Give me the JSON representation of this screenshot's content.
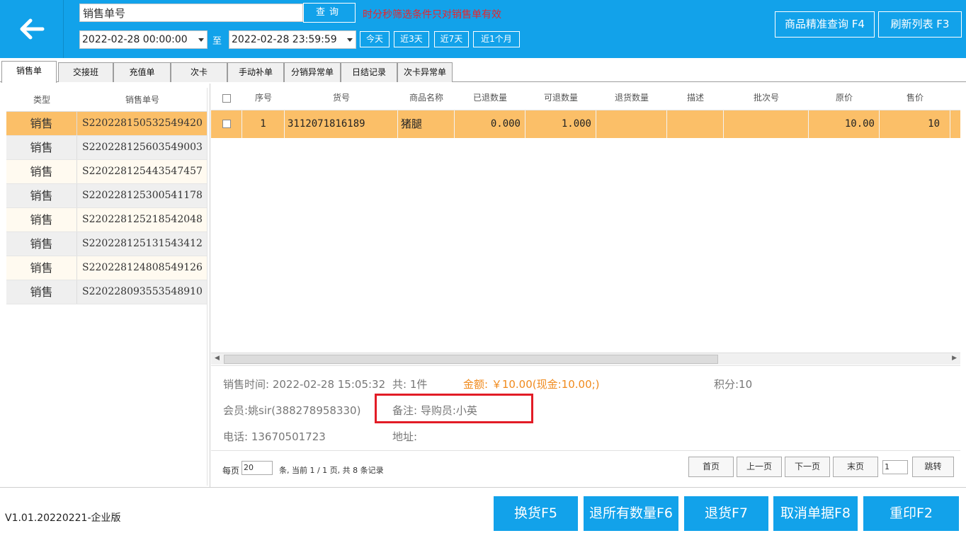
{
  "header": {
    "search_value": "销售单号",
    "query_label": "查询",
    "warning": "时分秒筛选条件只对销售单有效",
    "start_date": "2022-02-28 00:00:00",
    "to_label": "至",
    "end_date": "2022-02-28 23:59:59",
    "quick_ranges": [
      "今天",
      "近3天",
      "近7天",
      "近1个月"
    ],
    "exact_search_label": "商品精准查询 F4",
    "refresh_label": "刷新列表 F3"
  },
  "tabs": [
    "销售单",
    "交接班",
    "充值单",
    "次卡",
    "手动补单",
    "分销异常单",
    "日结记录",
    "次卡异常单"
  ],
  "order_list": {
    "headers": [
      "类型",
      "销售单号"
    ],
    "rows": [
      {
        "type": "销售",
        "no": "S220228150532549420",
        "selected": true
      },
      {
        "type": "销售",
        "no": "S220228125603549003"
      },
      {
        "type": "销售",
        "no": "S220228125443547457"
      },
      {
        "type": "销售",
        "no": "S220228125300541178"
      },
      {
        "type": "销售",
        "no": "S220228125218542048"
      },
      {
        "type": "销售",
        "no": "S220228125131543412"
      },
      {
        "type": "销售",
        "no": "S220228124808549126"
      },
      {
        "type": "销售",
        "no": "S220228093553548910"
      }
    ]
  },
  "detail_grid": {
    "headers": [
      "序号",
      "货号",
      "商品名称",
      "已退数量",
      "可退数量",
      "退货数量",
      "描述",
      "批次号",
      "原价",
      "售价"
    ],
    "rows": [
      {
        "seq": "1",
        "code": "3112071816189",
        "name": "猪腿",
        "returned": "0.000",
        "returnable": "1.000",
        "return_qty": "",
        "desc": "",
        "batch": "",
        "orig_price": "10.00",
        "price": "10"
      }
    ]
  },
  "info": {
    "sale_time": "销售时间: 2022-02-28 15:05:32",
    "total_count": "共: 1件",
    "amount": "金额: ￥10.00(现金:10.00;)",
    "points": "积分:10",
    "member": "会员:姚sir(388278958330)",
    "remark": "备注:  导购员:小英",
    "phone": "电话: 13670501723",
    "address": "地址:"
  },
  "pager": {
    "per_page_label": "每页",
    "per_page_value": "20",
    "summary": "条, 当前 1 / 1 页, 共 8 条记录",
    "first": "首页",
    "prev": "上一页",
    "next": "下一页",
    "last": "末页",
    "page_value": "1",
    "jump": "跳转"
  },
  "footer": {
    "version": "V1.01.20220221-企业版",
    "exchange": "换货F5",
    "return_all": "退所有数量F6",
    "return": "退货F7",
    "cancel": "取消单据F8",
    "reprint": "重印F2"
  },
  "colors": {
    "primary": "#12a2ea",
    "selected_row": "#fbbf68",
    "warning": "#e8242c",
    "amount": "#f08a1c",
    "highlight_border": "#e21c26"
  }
}
